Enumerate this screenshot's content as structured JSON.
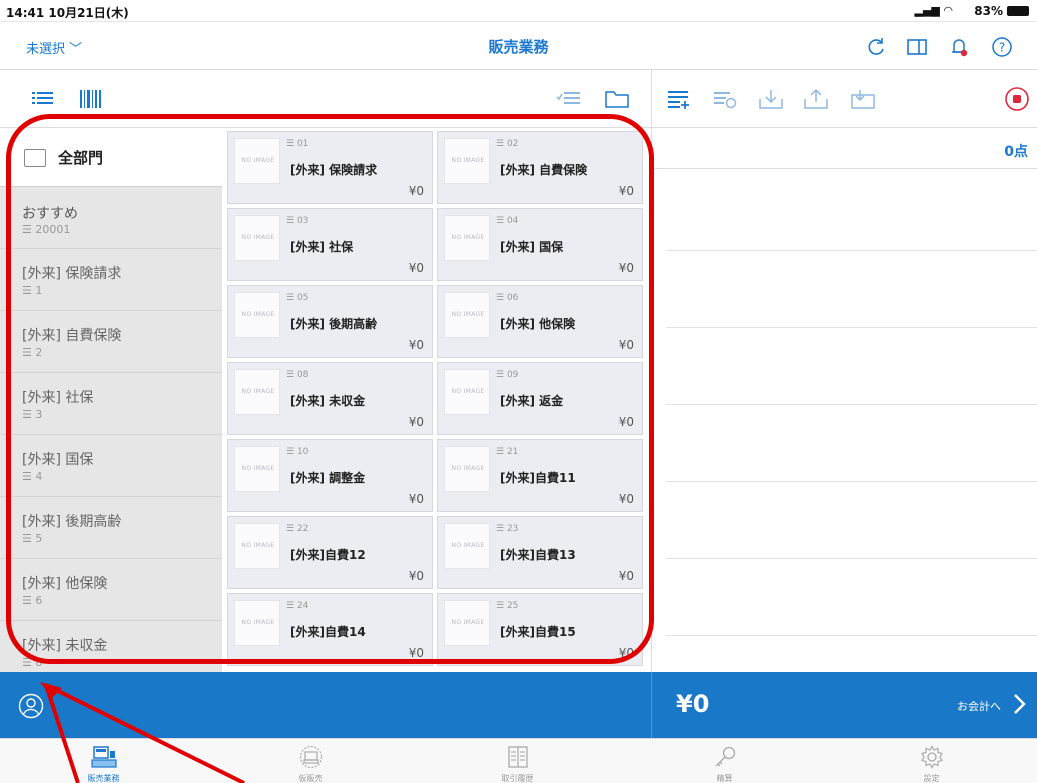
{
  "status_bar": {
    "time": "14:41  10月21日(木)",
    "battery": "83%"
  },
  "nav": {
    "unselected_label": "未選択",
    "title": "販売業務"
  },
  "categories": {
    "all_label": "全部門",
    "items": [
      {
        "name": "おすすめ",
        "code": "20001"
      },
      {
        "name": "[外来] 保険請求",
        "code": "1"
      },
      {
        "name": "[外来] 自費保険",
        "code": "2"
      },
      {
        "name": "[外来] 社保",
        "code": "3"
      },
      {
        "name": "[外来] 国保",
        "code": "4"
      },
      {
        "name": "[外来] 後期高齢",
        "code": "5"
      },
      {
        "name": "[外来] 他保険",
        "code": "6"
      },
      {
        "name": "[外来] 未収金",
        "code": "8"
      }
    ]
  },
  "products": {
    "no_image_text": "NO IMAGE",
    "items": [
      {
        "code": "01",
        "name": "[外来] 保険請求",
        "price": "¥0"
      },
      {
        "code": "02",
        "name": "[外来] 自費保険",
        "price": "¥0"
      },
      {
        "code": "03",
        "name": "[外来] 社保",
        "price": "¥0"
      },
      {
        "code": "04",
        "name": "[外来] 国保",
        "price": "¥0"
      },
      {
        "code": "05",
        "name": "[外来] 後期高齢",
        "price": "¥0"
      },
      {
        "code": "06",
        "name": "[外来] 他保険",
        "price": "¥0"
      },
      {
        "code": "08",
        "name": "[外来] 未収金",
        "price": "¥0"
      },
      {
        "code": "09",
        "name": "[外来] 返金",
        "price": "¥0"
      },
      {
        "code": "10",
        "name": "[外来] 調整金",
        "price": "¥0"
      },
      {
        "code": "21",
        "name": "[外来]自費11",
        "price": "¥0"
      },
      {
        "code": "22",
        "name": "[外来]自費12",
        "price": "¥0"
      },
      {
        "code": "23",
        "name": "[外来]自費13",
        "price": "¥0"
      },
      {
        "code": "24",
        "name": "[外来]自費14",
        "price": "¥0"
      },
      {
        "code": "25",
        "name": "[外来]自費15",
        "price": "¥0"
      }
    ]
  },
  "cart": {
    "count": "0点"
  },
  "total": {
    "amount": "¥0",
    "checkout_label": "お会計へ"
  },
  "tabs": [
    {
      "label": "販売業務",
      "icon": "register-icon",
      "active": true
    },
    {
      "label": "仮販売",
      "icon": "temp-sale-icon",
      "active": false
    },
    {
      "label": "取引履歴",
      "icon": "history-icon",
      "active": false
    },
    {
      "label": "精算",
      "icon": "key-icon",
      "active": false
    },
    {
      "label": "設定",
      "icon": "gear-icon",
      "active": false
    }
  ],
  "colors": {
    "accent": "#1b78d0",
    "total_bar": "#1a78c8",
    "annotation": "#e00000",
    "stop": "#e0263a"
  }
}
